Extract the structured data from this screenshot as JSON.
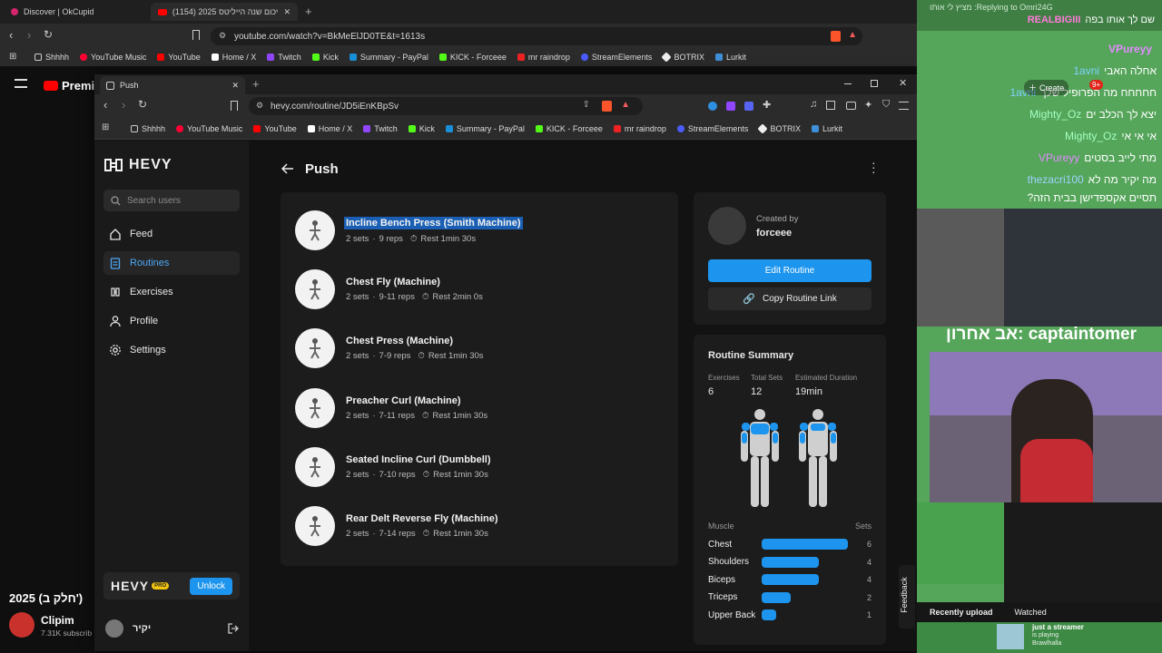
{
  "back_browser": {
    "tabs": [
      {
        "label": "Discover | OkCupid"
      },
      {
        "label": "(1154) סיכום שנה הייליטס 2025"
      }
    ],
    "url": "youtube.com/watch?v=BkMeElJD0TE&t=1613s",
    "bookmarks": [
      "Shhhh",
      "YouTube Music",
      "YouTube",
      "Home / X",
      "Twitch",
      "Kick",
      "Summary - PayPal",
      "KICK - Forceee",
      "mr raindrop",
      "StreamElements",
      "BOTRIX",
      "Lurkit"
    ]
  },
  "youtube_bg": {
    "logo_text": "Premi",
    "video_title": "2025 (חלק ב')",
    "channel_name": "Clipim",
    "subscribers": "7.31K subscrib"
  },
  "window": {
    "tab_label": "Push",
    "url": "hevy.com/routine/JD5iEnKBpSv",
    "bookmarks": [
      "Shhhh",
      "YouTube Music",
      "YouTube",
      "Home / X",
      "Twitch",
      "Kick",
      "Summary - PayPal",
      "KICK - Forceee",
      "mr raindrop",
      "StreamElements",
      "BOTRIX",
      "Lurkit"
    ]
  },
  "hevy": {
    "logo": "HEVY",
    "search_placeholder": "Search users",
    "nav": [
      {
        "label": "Feed"
      },
      {
        "label": "Routines"
      },
      {
        "label": "Exercises"
      },
      {
        "label": "Profile"
      },
      {
        "label": "Settings"
      }
    ],
    "pro": {
      "logo": "HEVY",
      "badge": "PRO",
      "unlock": "Unlock"
    },
    "user": {
      "name": "יקיר"
    },
    "page_title": "Push",
    "exercises": [
      {
        "name": "Incline Bench Press (Smith Machine)",
        "sets": "2 sets",
        "reps": "9 reps",
        "rest": "Rest 1min 30s"
      },
      {
        "name": "Chest Fly (Machine)",
        "sets": "2 sets",
        "reps": "9-11 reps",
        "rest": "Rest 2min 0s"
      },
      {
        "name": "Chest Press (Machine)",
        "sets": "2 sets",
        "reps": "7-9 reps",
        "rest": "Rest 1min 30s"
      },
      {
        "name": "Preacher Curl (Machine)",
        "sets": "2 sets",
        "reps": "7-11 reps",
        "rest": "Rest 1min 30s"
      },
      {
        "name": "Seated Incline Curl (Dumbbell)",
        "sets": "2 sets",
        "reps": "7-10 reps",
        "rest": "Rest 1min 30s"
      },
      {
        "name": "Rear Delt Reverse Fly (Machine)",
        "sets": "2 sets",
        "reps": "7-14 reps",
        "rest": "Rest 1min 30s"
      }
    ],
    "creator": {
      "label": "Created by",
      "name": "forceee"
    },
    "edit_button": "Edit Routine",
    "copy_button": "Copy Routine Link",
    "summary": {
      "title": "Routine Summary",
      "stats": [
        {
          "label": "Exercises",
          "value": "6"
        },
        {
          "label": "Total Sets",
          "value": "12"
        },
        {
          "label": "Estimated Duration",
          "value": "19min"
        }
      ],
      "muscle_header": "Muscle",
      "sets_header": "Sets",
      "muscles": [
        {
          "name": "Chest",
          "sets": 6
        },
        {
          "name": "Shoulders",
          "sets": 4
        },
        {
          "name": "Biceps",
          "sets": 4
        },
        {
          "name": "Triceps",
          "sets": 2
        },
        {
          "name": "Upper Back",
          "sets": 1
        }
      ],
      "max_sets": 6
    },
    "feedback": "Feedback",
    "accent": "#1d95ee"
  },
  "stream": {
    "reply_header": "Replying to Omri24G: מציץ לי אותו",
    "reply_text": "שם לך אותו בפה",
    "reply_user": "REALBIGIII",
    "messages": [
      {
        "user": "VPureyy",
        "text": ""
      },
      {
        "user": "1avni",
        "text": "אחלה האבי"
      },
      {
        "user": "1avni",
        "text": "חחחחח מה הפרופיל שלך"
      },
      {
        "user": "Mighty_Oz",
        "text": "יצא לך הכלב ים"
      },
      {
        "user": "Mighty_Oz",
        "text": "אי אי אי"
      },
      {
        "user": "VPureyy",
        "text": "מתי לייב בסטים"
      },
      {
        "user": "thezacri100",
        "text": "מה יקיר מה לא"
      },
      {
        "user": "",
        "text": "תסיים אקספדישן בבית הזה?"
      }
    ],
    "create_label": "Create",
    "notif_badge": "9+",
    "banner": "captaintomer :אב אחרון",
    "recently_uploaded": "Recently upload",
    "watched": "Watched",
    "streamer_title": "just a streamer",
    "streamer_status": "is playing",
    "streamer_game": "Brawlhalla"
  }
}
